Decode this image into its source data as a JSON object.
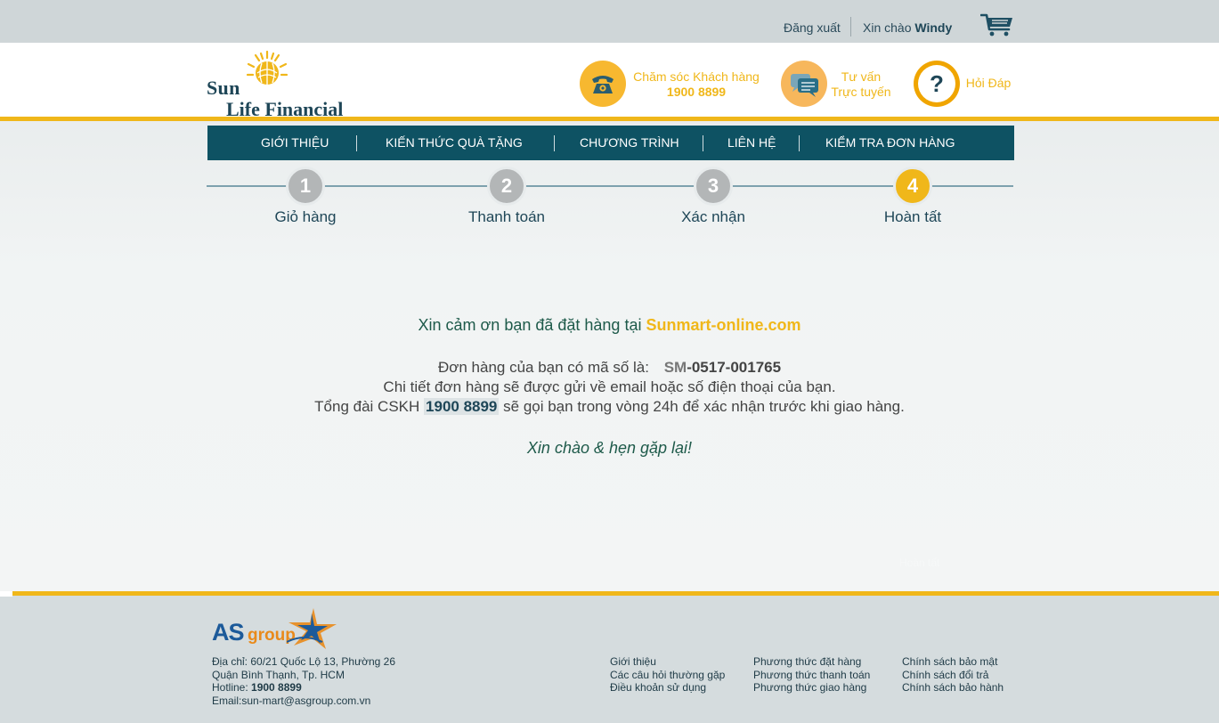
{
  "topbar": {
    "logout": "Đăng xuất",
    "greeting_prefix": "Xin chào",
    "username": "Windy",
    "cart_icon": "cart-icon"
  },
  "header": {
    "logo": {
      "line1": "Sun",
      "line2": "Life Financial"
    },
    "support": {
      "label": "Chăm sóc Khách hàng",
      "phone": "1900 8899",
      "icon": "phone-icon"
    },
    "chat": {
      "line1": "Tư vấn",
      "line2": "Trực tuyến",
      "icon": "chat-bubble-icon"
    },
    "faq": {
      "label": "Hỏi Đáp",
      "icon": "question-icon",
      "icon_glyph": "?"
    }
  },
  "nav": {
    "items": [
      "GIỚI THIỆU",
      "KIẾN THỨC QUÀ TẶNG",
      "CHƯƠNG TRÌNH",
      "LIÊN HỆ",
      "KIỂM TRA ĐƠN HÀNG"
    ]
  },
  "steps": [
    {
      "num": "1",
      "label": "Giỏ hàng"
    },
    {
      "num": "2",
      "label": "Thanh toán"
    },
    {
      "num": "3",
      "label": "Xác nhận"
    },
    {
      "num": "4",
      "label": "Hoàn tất",
      "active": true
    }
  ],
  "confirmation": {
    "thanks_prefix": "Xin cảm ơn bạn đã đặt hàng tại",
    "site": "Sunmart-online.com",
    "order_prefix": "Đơn hàng của bạn có mã số là:",
    "order_code_prefix": "SM",
    "order_code_rest": "-0517-001765",
    "detail": "Chi tiết đơn hàng sẽ được gửi về email hoặc số điện thoại của bạn.",
    "hotline_prefix": "Tổng đài CSKH",
    "hotline": "1900 8899",
    "hotline_suffix": "sẽ gọi bạn trong vòng 24h để xác nhận trước khi giao hàng.",
    "goodbye": "Xin chào & hẹn gặp lại!",
    "ghost": "Hoàn tất"
  },
  "footer": {
    "brand": {
      "as": "AS",
      "group": "group"
    },
    "address": {
      "line1": "Địa chỉ: 60/21 Quốc Lộ 13, Phường 26",
      "line2": "Quận Bình Thạnh, Tp. HCM",
      "hotline_prefix": "Hotline:",
      "hotline": "1900 8899",
      "email": "Email:sun-mart@asgroup.com.vn"
    },
    "links_col1": [
      "Giới thiệu",
      "Các câu hỏi thường gặp",
      "Điều khoản sử dụng"
    ],
    "links_col2": [
      "Phương thức đặt hàng",
      "Phương thức thanh toán",
      "Phương thức giao hàng"
    ],
    "links_col3": [
      "Chính sách bảo mật",
      "Chính sách đổi trả",
      "Chính sách bảo hành"
    ]
  },
  "colors": {
    "accent": "#f0b71a",
    "nav": "#0e5263",
    "text_dark": "#1e4657"
  }
}
